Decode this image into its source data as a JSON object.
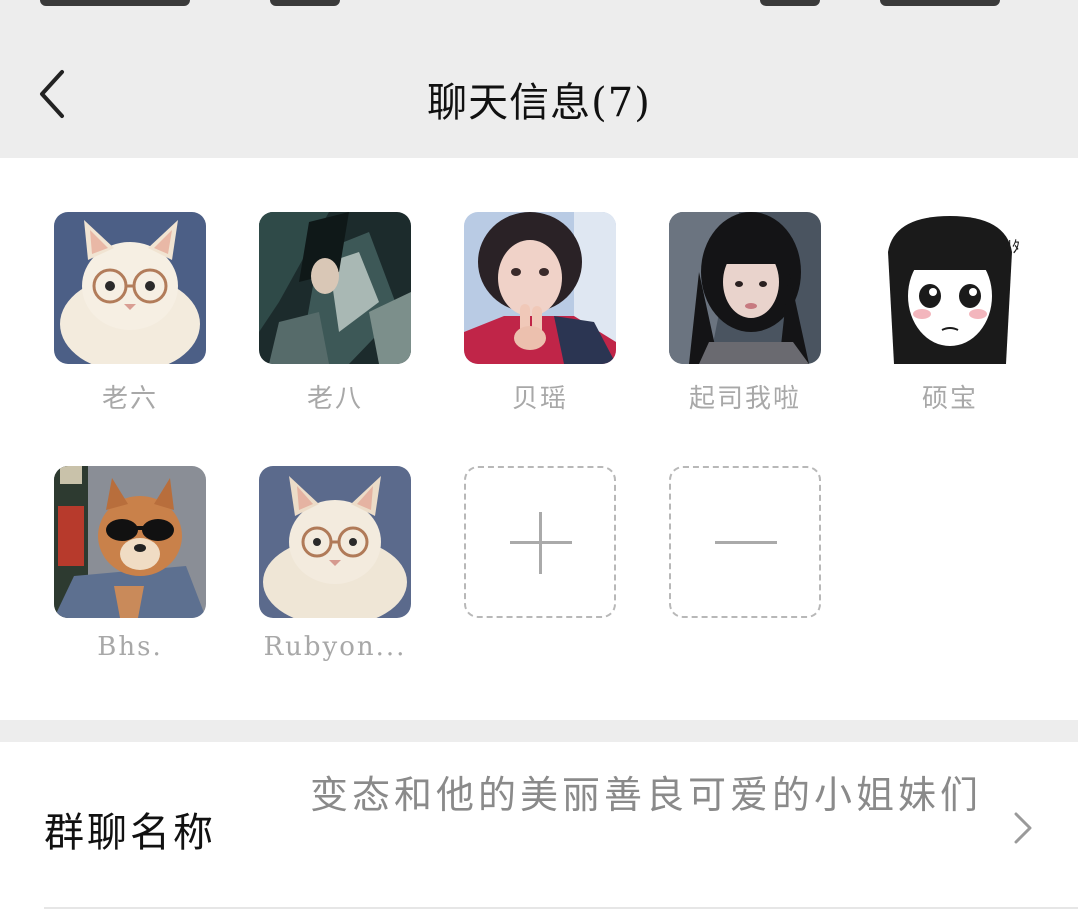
{
  "header": {
    "title": "聊天信息(7)"
  },
  "members": [
    {
      "name": "老六",
      "avatar": "white-cat-glasses-avatar"
    },
    {
      "name": "老八",
      "avatar": "anime-character-dark-avatar"
    },
    {
      "name": "贝瑶",
      "avatar": "girl-peace-sign-avatar"
    },
    {
      "name": "起司我啦",
      "avatar": "girl-long-hair-avatar"
    },
    {
      "name": "硕宝",
      "avatar": "manga-girl-avatar"
    },
    {
      "name": "Bhs.",
      "avatar": "dog-sunglasses-avatar"
    },
    {
      "name": "Rubyon...",
      "avatar": "white-cat-glasses-avatar"
    }
  ],
  "actions": {
    "add": "plus-icon",
    "remove": "minus-icon"
  },
  "group_name": {
    "label": "群聊名称",
    "value": "变态和他的美丽善良可爱的小姐妹们"
  },
  "colors": {
    "nav_bg": "#ededed",
    "page_bg": "#ffffff",
    "member_name": "#a8a8a8",
    "value_text": "#8a8a8a"
  }
}
